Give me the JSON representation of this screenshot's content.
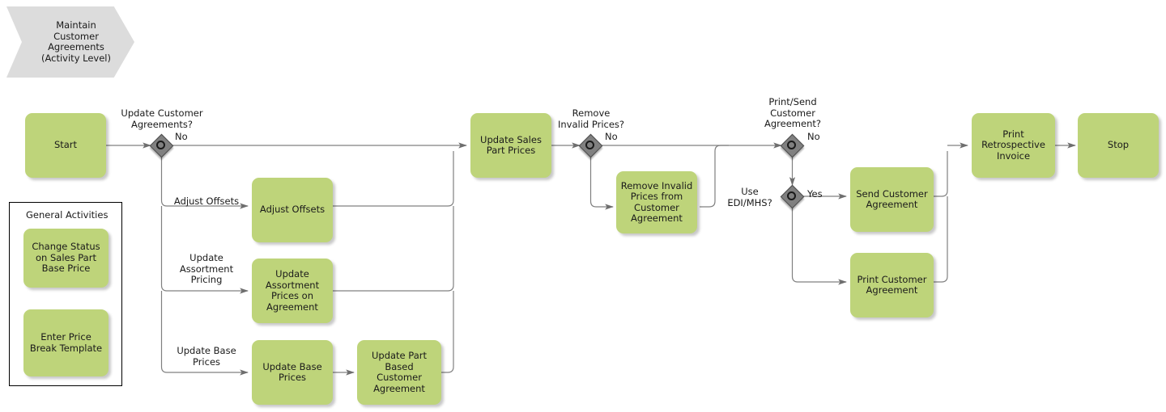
{
  "diagram": {
    "title": "Maintain Customer Agreements (Activity Level)",
    "type": "flowchart",
    "colors": {
      "activity_fill": "#bed47a",
      "phase_fill": "#dcdcdc",
      "gateway_fill": "#808080",
      "gateway_border": "#4d4d4d",
      "edge": "#808080",
      "text": "#1a1a1a",
      "group_border": "#000000",
      "background": "#ffffff"
    }
  },
  "phase": {
    "label": "Maintain\nCustomer\nAgreements\n(Activity Level)"
  },
  "group": {
    "title": "General Activities",
    "activities": [
      {
        "label": "Change Status\non Sales Part\nBase Price"
      },
      {
        "label": "Enter Price\nBreak Template"
      }
    ]
  },
  "activities": [
    {
      "id": "start",
      "label": "Start"
    },
    {
      "id": "adjust-offsets",
      "label": "Adjust Offsets"
    },
    {
      "id": "update-assortment-prices",
      "label": "Update\nAssortment\nPrices on\nAgreement"
    },
    {
      "id": "update-base-prices",
      "label": "Update Base\nPrices"
    },
    {
      "id": "update-part-based-customer-agreement",
      "label": "Update Part\nBased Customer\nAgreement"
    },
    {
      "id": "update-sales-part-prices",
      "label": "Update Sales\nPart Prices"
    },
    {
      "id": "remove-invalid-prices",
      "label": "Remove Invalid\nPrices from\nCustomer\nAgreement"
    },
    {
      "id": "send-customer-agreement",
      "label": "Send Customer\nAgreement"
    },
    {
      "id": "print-customer-agreement",
      "label": "Print Customer\nAgreement"
    },
    {
      "id": "print-retrospective-invoice",
      "label": "Print\nRetrospective\nInvoice"
    },
    {
      "id": "stop",
      "label": "Stop"
    }
  ],
  "gateways": [
    {
      "id": "update-customer-agreements",
      "label": "Update Customer\nAgreements?"
    },
    {
      "id": "remove-invalid-prices-gw",
      "label": "Remove\nInvalid Prices?"
    },
    {
      "id": "print-send-customer-agreement-gw",
      "label": "Print/Send\nCustomer\nAgreement?"
    },
    {
      "id": "use-edi-mhs-gw",
      "label": "Use\nEDI/MHS?"
    }
  ],
  "edge_labels": [
    {
      "id": "gw1-no",
      "text": "No"
    },
    {
      "id": "gw1-adjust-offsets",
      "text": "Adjust Offsets"
    },
    {
      "id": "gw1-update-assortment-pricing",
      "text": "Update\nAssortment\nPricing"
    },
    {
      "id": "gw1-update-base-prices",
      "text": "Update Base\nPrices"
    },
    {
      "id": "gw2-no",
      "text": "No"
    },
    {
      "id": "gw3-no",
      "text": "No"
    },
    {
      "id": "gw4-yes",
      "text": "Yes"
    }
  ]
}
